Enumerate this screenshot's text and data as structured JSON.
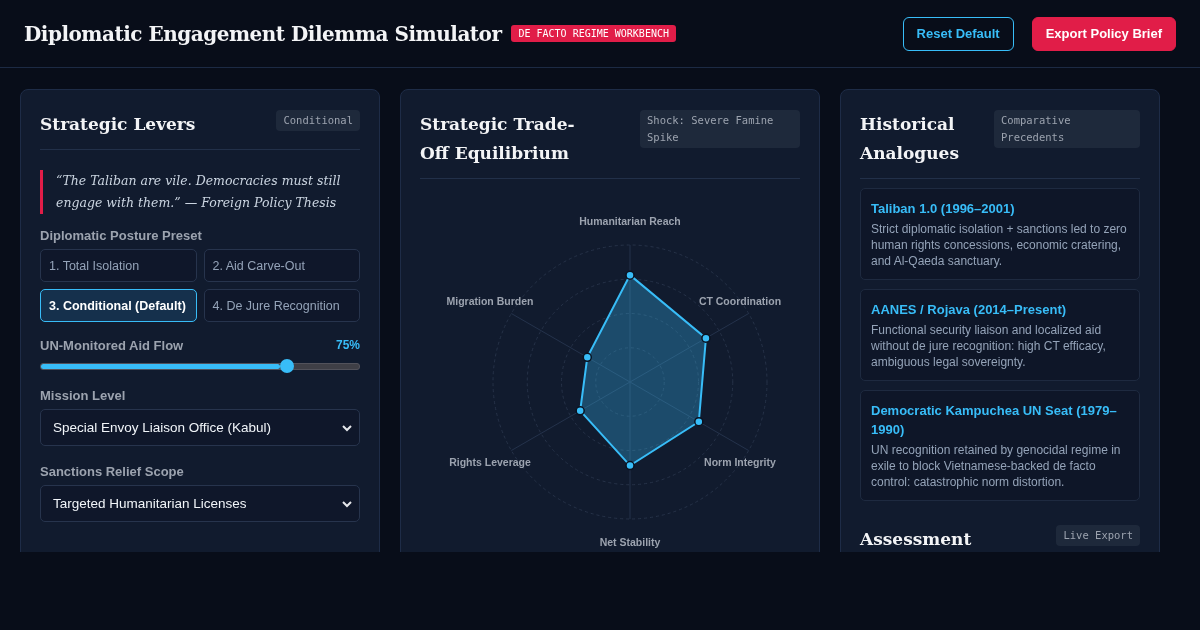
{
  "header": {
    "title": "Diplomatic Engagement Dilemma Simulator",
    "badge": "DE FACTO REGIME WORKBENCH",
    "buttons": [
      {
        "label": "Reset Default",
        "kind": "outline"
      },
      {
        "label": "Export Policy Brief",
        "kind": "primary"
      }
    ]
  },
  "levers": {
    "title": "Strategic Levers",
    "badge": "Conditional",
    "quote": "“The Taliban are vile. Democracies must still engage with them.” — Foreign Policy Thesis",
    "preset_label": "Diplomatic Posture Preset",
    "presets": [
      {
        "label": "1. Total Isolation",
        "selected": false
      },
      {
        "label": "2. Aid Carve-Out",
        "selected": false
      },
      {
        "label": "3. Conditional (Default)",
        "selected": true
      },
      {
        "label": "4. De Jure Recognition",
        "selected": false
      }
    ],
    "aid_flow": {
      "label": "UN-Monitored Aid Flow",
      "reading": "75%",
      "level": 0.75
    },
    "mission": {
      "label": "Mission Level",
      "value": "Special Envoy Liaison Office (Kabul)"
    },
    "sanctions": {
      "label": "Sanctions Relief Scope",
      "value": "Targeted Humanitarian Licenses"
    }
  },
  "tradeoff": {
    "title": "Strategic Trade-Off Equilibrium",
    "badge": "Shock: Severe Famine Spike",
    "axes": [
      "Humanitarian Reach",
      "Migration Burden",
      "CT Coordination",
      "Rights Leverage",
      "Norm Integrity",
      "Net Stability"
    ]
  },
  "analogues": {
    "title": "Historical Analogues",
    "badge": "Comparative Precedents",
    "cases": [
      {
        "title": "Taliban 1.0 (1996–2001)",
        "text": "Strict diplomatic isolation + sanctions led to zero human rights concessions, economic cratering, and Al-Qaeda sanctuary."
      },
      {
        "title": "AANES / Rojava (2014–Present)",
        "text": "Functional security liaison and localized aid without de jure recognition: high CT efficacy, ambiguous legal sovereignty."
      },
      {
        "title": "Democratic Kampuchea UN Seat (1979–1990)",
        "text": "UN recognition retained by genocidal regime in exile to block Vietnamese-backed de facto control: catastrophic norm distortion."
      }
    ]
  },
  "assessment": {
    "title": "Assessment",
    "badge": "Live Export"
  }
}
